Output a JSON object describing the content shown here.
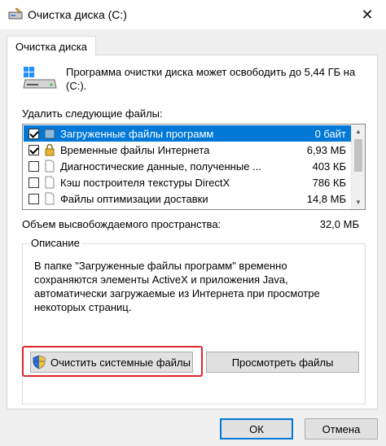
{
  "window": {
    "title": "Очистка диска  (C:)",
    "close_glyph": "✕"
  },
  "tab": {
    "label": "Очистка диска"
  },
  "info": {
    "text": "Программа очистки диска может освободить до 5,44 ГБ на (C:)."
  },
  "files": {
    "label": "Удалить следующие файлы:",
    "items": [
      {
        "name": "Загруженные файлы программ",
        "size": "0 байт",
        "checked": true,
        "selected": true
      },
      {
        "name": "Временные файлы Интернета",
        "size": "6,93 МБ",
        "checked": true,
        "selected": false
      },
      {
        "name": "Диагностические данные, полученные ...",
        "size": "403 КБ",
        "checked": false,
        "selected": false
      },
      {
        "name": "Кэш построителя текстуры DirectX",
        "size": "786 КБ",
        "checked": false,
        "selected": false
      },
      {
        "name": "Файлы оптимизации доставки",
        "size": "14,8 МБ",
        "checked": false,
        "selected": false
      }
    ]
  },
  "space": {
    "label": "Объем высвобождаемого пространства:",
    "value": "32,0 МБ"
  },
  "description": {
    "legend": "Описание",
    "text": "В папке \"Загруженные файлы программ\" временно сохраняются элементы ActiveX и приложения Java, автоматически загружаемые из Интернета при просмотре некоторых страниц."
  },
  "buttons": {
    "cleanup_system": "Очистить системные файлы",
    "view_files": "Просмотреть файлы",
    "ok": "ОК",
    "cancel": "Отмена"
  },
  "colors": {
    "selection": "#0078d7",
    "highlight_border": "#e0262b"
  }
}
